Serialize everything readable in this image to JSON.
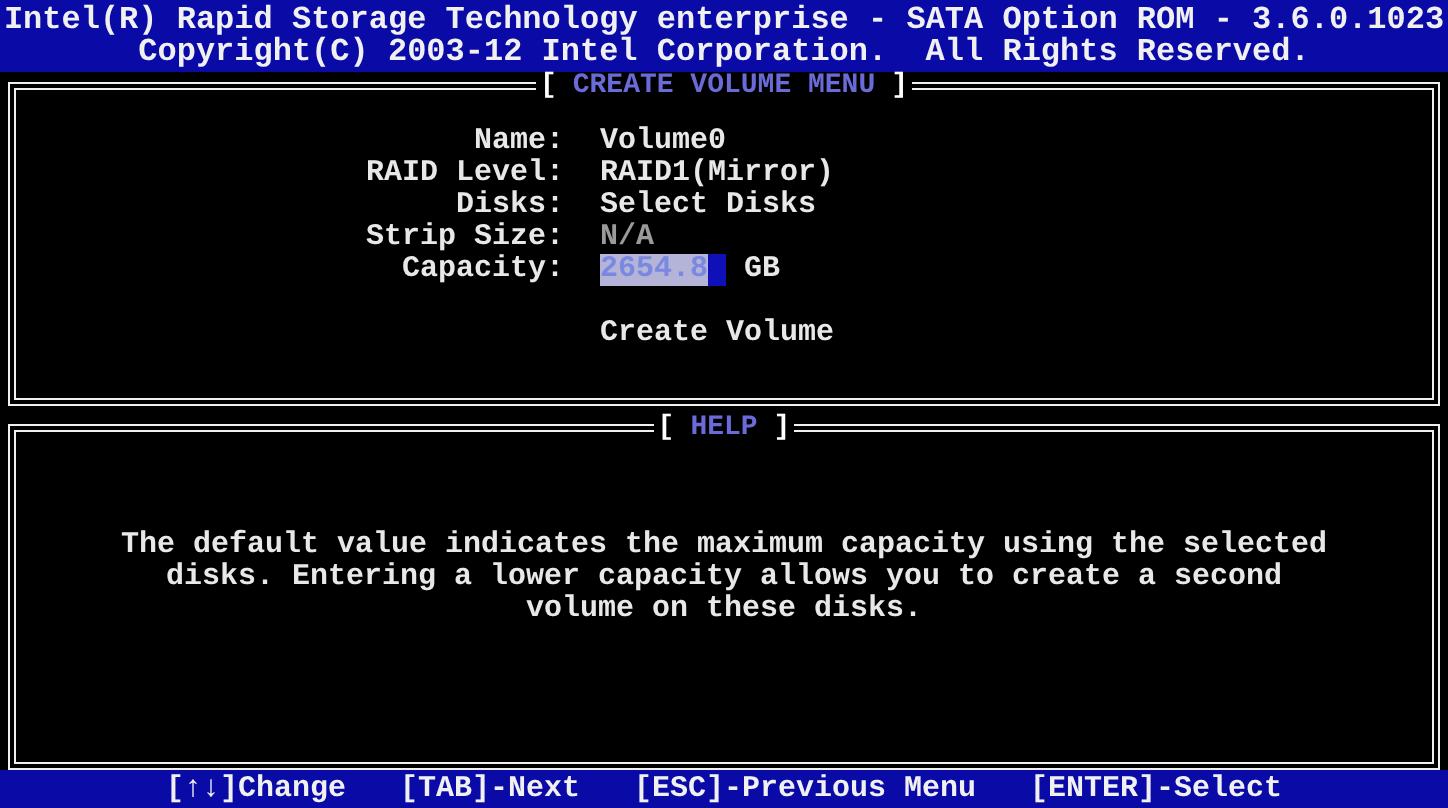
{
  "header": {
    "title": "Intel(R) Rapid Storage Technology enterprise - SATA Option ROM - 3.6.0.1023",
    "copyright": "Copyright(C) 2003-12 Intel Corporation.  All Rights Reserved."
  },
  "create_panel": {
    "bracket_left": "[",
    "title": "CREATE VOLUME MENU",
    "bracket_right": "]",
    "fields": [
      {
        "label": "Name:",
        "value": "Volume0",
        "disabled": false,
        "selected": false
      },
      {
        "label": "RAID Level:",
        "value": "RAID1(Mirror)",
        "disabled": false,
        "selected": false
      },
      {
        "label": "Disks:",
        "value": "Select Disks",
        "disabled": false,
        "selected": false
      },
      {
        "label": "Strip Size:",
        "value": "N/A",
        "disabled": true,
        "selected": false
      },
      {
        "label": "Capacity:",
        "value": "2654.8",
        "unit": "GB",
        "disabled": false,
        "selected": true
      }
    ],
    "actions": [
      {
        "label": "Create Volume",
        "selected": false
      }
    ]
  },
  "help_panel": {
    "bracket_left": "[",
    "title": "HELP",
    "bracket_right": "]",
    "text": "The default value indicates the maximum capacity using the selected disks. Entering a lower capacity allows you to create a second volume on these disks."
  },
  "footer": {
    "keys": [
      "[↑↓]Change",
      "[TAB]-Next",
      "[ESC]-Previous Menu",
      "[ENTER]-Select"
    ]
  }
}
